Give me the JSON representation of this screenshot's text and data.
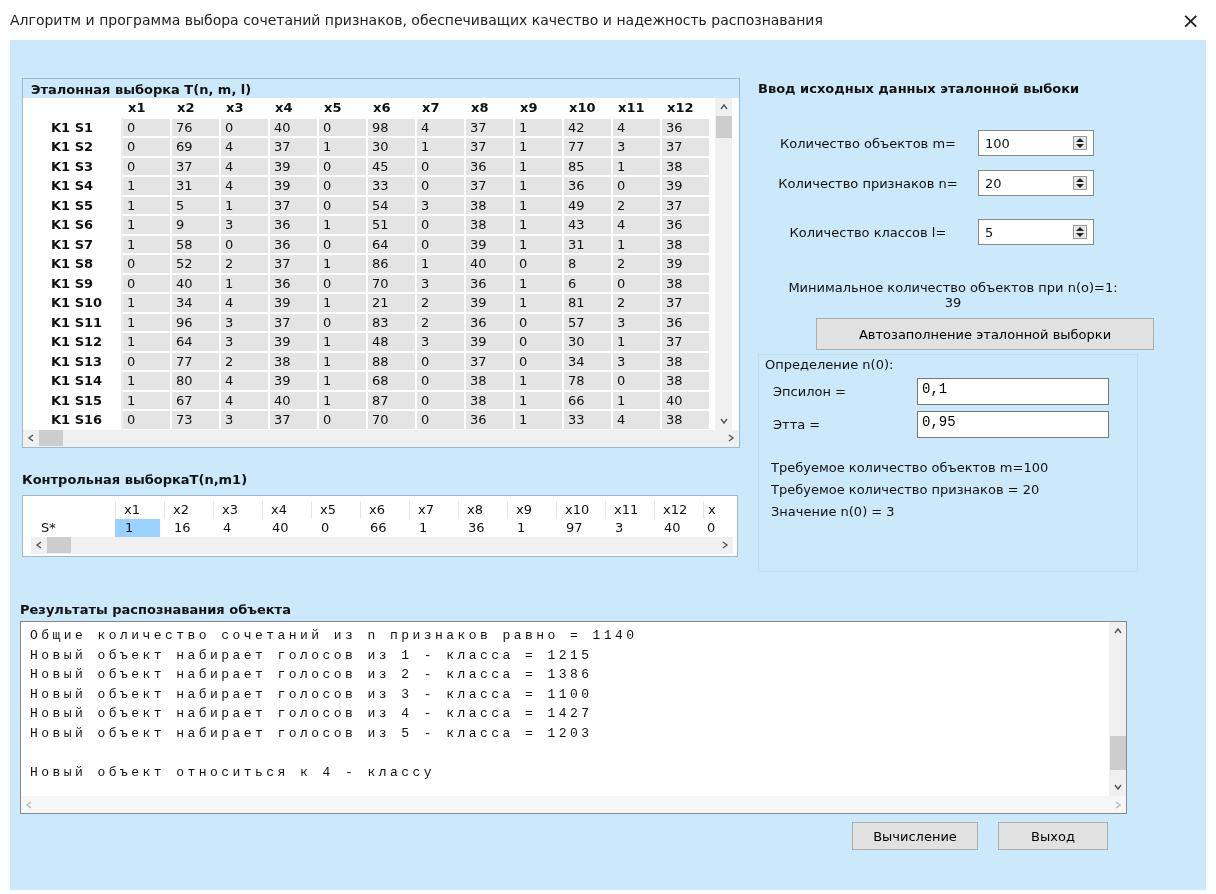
{
  "window": {
    "title": "Алгоритм и программа выбора сочетаний признаков, обеспечиващих качество и надежность распознавания",
    "close": "×"
  },
  "reference": {
    "title": "Эталонная выборка T(n, m, l)",
    "columns": [
      "x1",
      "x2",
      "x3",
      "x4",
      "x5",
      "x6",
      "x7",
      "x8",
      "x9",
      "x10",
      "x11",
      "x12"
    ],
    "rows": [
      {
        "label": "K1 S1",
        "cells": [
          "0",
          "76",
          "0",
          "40",
          "0",
          "98",
          "4",
          "37",
          "1",
          "42",
          "4",
          "36"
        ]
      },
      {
        "label": "K1 S2",
        "cells": [
          "0",
          "69",
          "4",
          "37",
          "1",
          "30",
          "1",
          "37",
          "1",
          "77",
          "3",
          "37"
        ]
      },
      {
        "label": "K1 S3",
        "cells": [
          "0",
          "37",
          "4",
          "39",
          "0",
          "45",
          "0",
          "36",
          "1",
          "85",
          "1",
          "38"
        ]
      },
      {
        "label": "K1 S4",
        "cells": [
          "1",
          "31",
          "4",
          "39",
          "0",
          "33",
          "0",
          "37",
          "1",
          "36",
          "0",
          "39"
        ]
      },
      {
        "label": "K1 S5",
        "cells": [
          "1",
          "5",
          "1",
          "37",
          "0",
          "54",
          "3",
          "38",
          "1",
          "49",
          "2",
          "37"
        ]
      },
      {
        "label": "K1 S6",
        "cells": [
          "1",
          "9",
          "3",
          "36",
          "1",
          "51",
          "0",
          "38",
          "1",
          "43",
          "4",
          "36"
        ]
      },
      {
        "label": "K1 S7",
        "cells": [
          "1",
          "58",
          "0",
          "36",
          "0",
          "64",
          "0",
          "39",
          "1",
          "31",
          "1",
          "38"
        ]
      },
      {
        "label": "K1 S8",
        "cells": [
          "0",
          "52",
          "2",
          "37",
          "1",
          "86",
          "1",
          "40",
          "0",
          "8",
          "2",
          "39"
        ]
      },
      {
        "label": "K1 S9",
        "cells": [
          "0",
          "40",
          "1",
          "36",
          "0",
          "70",
          "3",
          "36",
          "1",
          "6",
          "0",
          "38"
        ]
      },
      {
        "label": "K1 S10",
        "cells": [
          "1",
          "34",
          "4",
          "39",
          "1",
          "21",
          "2",
          "39",
          "1",
          "81",
          "2",
          "37"
        ]
      },
      {
        "label": "K1 S11",
        "cells": [
          "1",
          "96",
          "3",
          "37",
          "0",
          "83",
          "2",
          "36",
          "0",
          "57",
          "3",
          "36"
        ]
      },
      {
        "label": "K1 S12",
        "cells": [
          "1",
          "64",
          "3",
          "39",
          "1",
          "48",
          "3",
          "39",
          "0",
          "30",
          "1",
          "37"
        ]
      },
      {
        "label": "K1 S13",
        "cells": [
          "0",
          "77",
          "2",
          "38",
          "1",
          "88",
          "0",
          "37",
          "0",
          "34",
          "3",
          "38"
        ]
      },
      {
        "label": "K1 S14",
        "cells": [
          "1",
          "80",
          "4",
          "39",
          "1",
          "68",
          "0",
          "38",
          "1",
          "78",
          "0",
          "38"
        ]
      },
      {
        "label": "K1 S15",
        "cells": [
          "1",
          "67",
          "4",
          "40",
          "1",
          "87",
          "0",
          "38",
          "1",
          "66",
          "1",
          "40"
        ]
      },
      {
        "label": "K1 S16",
        "cells": [
          "0",
          "73",
          "3",
          "37",
          "0",
          "70",
          "0",
          "36",
          "1",
          "33",
          "4",
          "38"
        ]
      }
    ]
  },
  "control": {
    "title": "Контрольная выборкаT(n,m1)",
    "columns": [
      "x1",
      "x2",
      "x3",
      "x4",
      "x5",
      "x6",
      "x7",
      "x8",
      "x9",
      "x10",
      "x11",
      "x12",
      "x"
    ],
    "rows": [
      {
        "label": "S*",
        "cells": [
          {
            "value": "1",
            "selected": true
          },
          {
            "value": "16",
            "selected": false
          },
          {
            "value": "4",
            "selected": false
          },
          {
            "value": "40",
            "selected": false
          },
          {
            "value": "0",
            "selected": false
          },
          {
            "value": "66",
            "selected": false
          },
          {
            "value": "1",
            "selected": false
          },
          {
            "value": "36",
            "selected": false
          },
          {
            "value": "1",
            "selected": false
          },
          {
            "value": "97",
            "selected": false
          },
          {
            "value": "3",
            "selected": false
          },
          {
            "value": "40",
            "selected": false
          },
          {
            "value": "0",
            "selected": false
          }
        ]
      }
    ]
  },
  "input": {
    "title": "Ввод исходных данных эталонной выбоки",
    "params": [
      {
        "label": "Количество объектов m=",
        "value": "100"
      },
      {
        "label": "Количество признаков n=",
        "value": "20"
      },
      {
        "label": "Количество классов l=",
        "value": "5"
      }
    ],
    "min_objects": {
      "label": "Минимальное количество объектов при n(o)=1:",
      "value": "39"
    },
    "autofill_button": "Автозаполнение эталонной выборки",
    "n0_group": {
      "title": "Определение n(0):",
      "fields": [
        {
          "label": "Эпсилон =",
          "value": "0,1"
        },
        {
          "label": "Этта =",
          "value": "0,95"
        }
      ]
    },
    "summary": [
      "Требуемое количество объектов m=100",
      "Требуемое количество признаков = 20",
      "Значение n(0) = 3"
    ]
  },
  "results": {
    "title": "Результаты распознавания объекта",
    "lines": [
      "Общие количество сочетаний из n признаков равно = 1140",
      "Новый объект набирает голосов из 1 - класса = 1215",
      "Новый объект набирает голосов из 2 - класса = 1386",
      "Новый объект набирает голосов из 3 - класса = 1100",
      "Новый объект набирает голосов из 4 - класса = 1427",
      "Новый объект набирает голосов из 5 - класса = 1203"
    ],
    "conclusion": "Новый объект относиться к 4 - классу"
  },
  "buttons": [
    "Вычисление",
    "Выход"
  ]
}
